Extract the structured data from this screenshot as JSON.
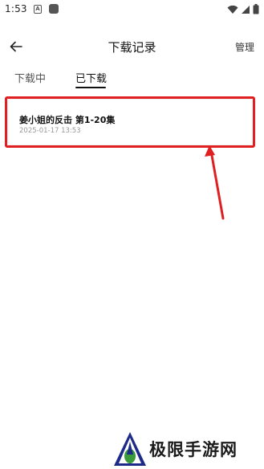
{
  "status_bar": {
    "time": "1:53",
    "notification_icon_letter": "A"
  },
  "header": {
    "title": "下载记录",
    "manage_label": "管理"
  },
  "tabs": [
    {
      "label": "下载中",
      "active": false
    },
    {
      "label": "已下载",
      "active": true
    }
  ],
  "downloads": [
    {
      "title": "姜小姐的反击 第1-20集",
      "timestamp": "2025-01-17 13:53"
    }
  ],
  "annotation": {
    "color": "#e02020"
  },
  "watermark": {
    "text": "极限手游网"
  }
}
